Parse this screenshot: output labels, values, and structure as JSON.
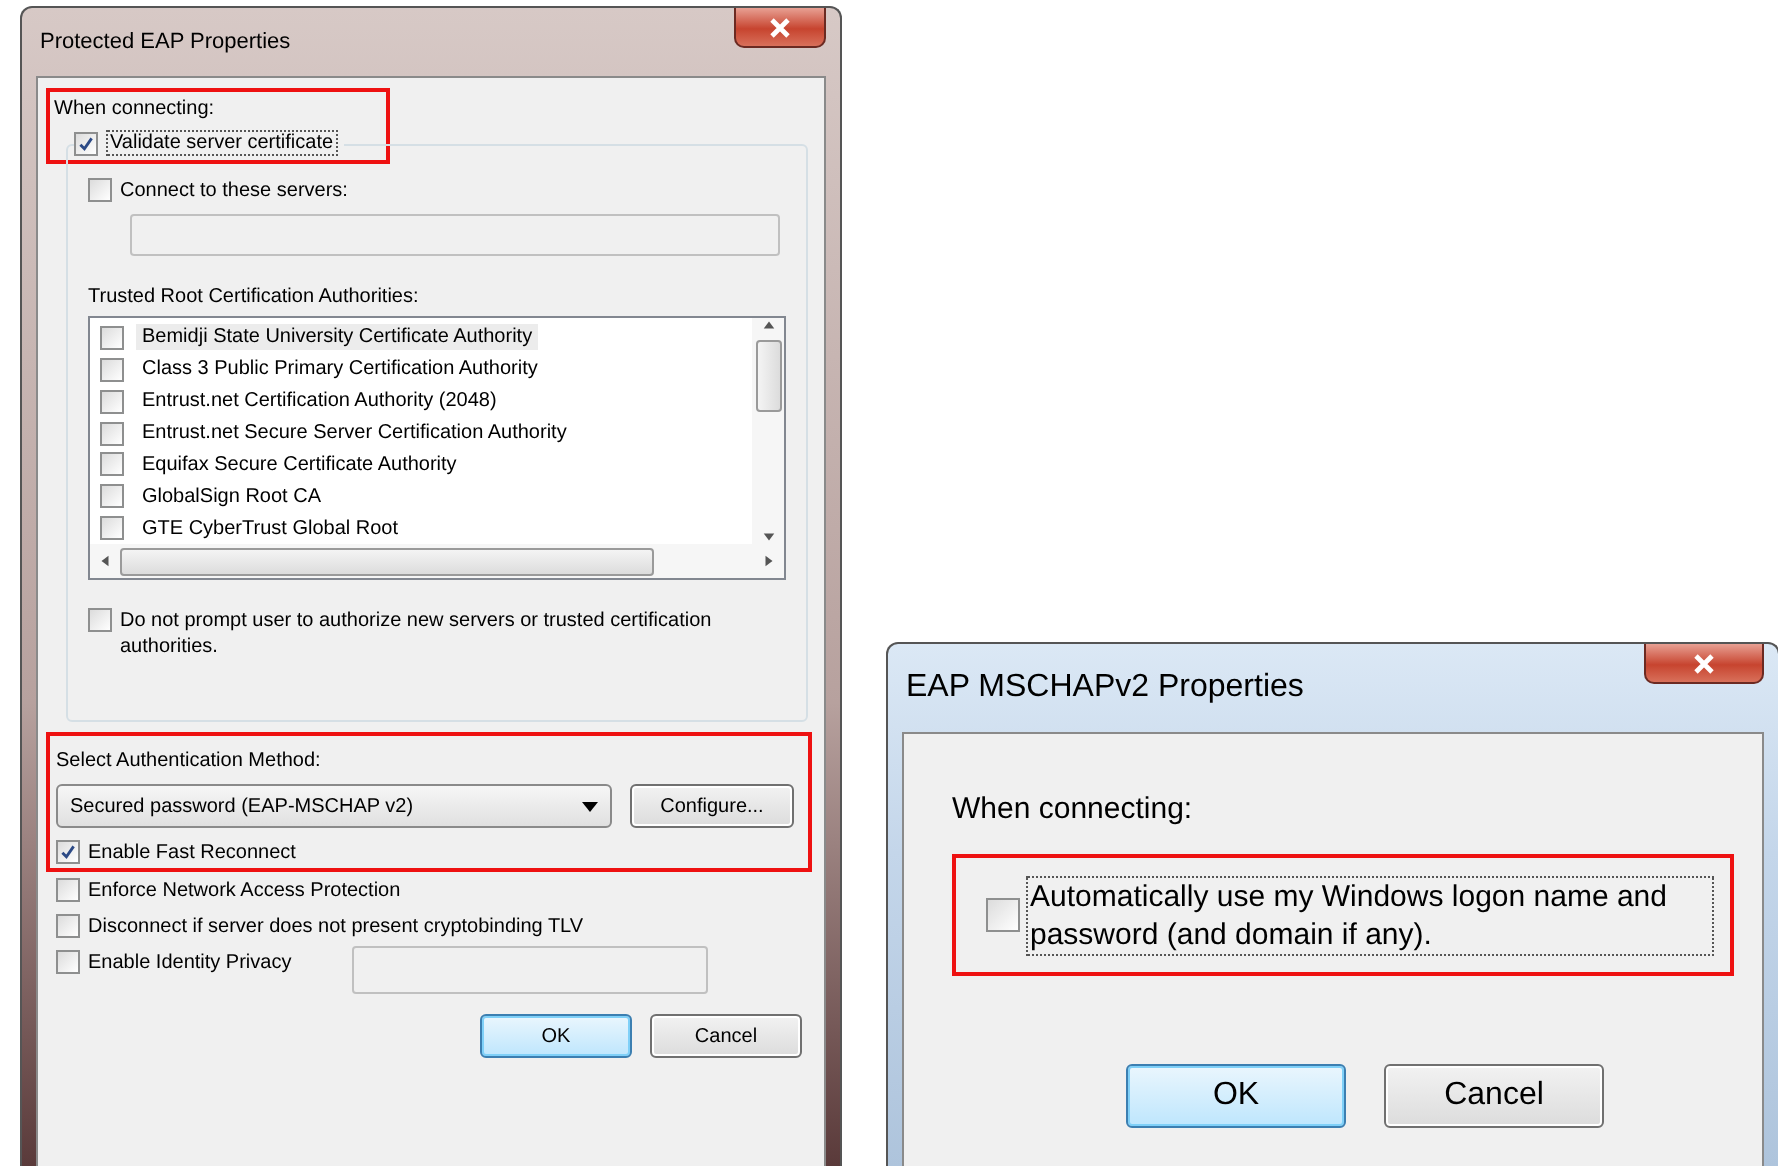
{
  "protected_eap": {
    "title": "Protected EAP Properties",
    "when_connecting": {
      "label": "When connecting:",
      "highlighted": true,
      "validate": {
        "label": "Validate server certificate",
        "checked": true
      }
    },
    "connect_servers": {
      "label": "Connect to these servers:",
      "checked": false
    },
    "trusted_label": "Trusted Root Certification Authorities:",
    "authorities": [
      {
        "name": "Bemidji State University Certificate Authority",
        "checked": false,
        "selected": true
      },
      {
        "name": "Class 3 Public Primary Certification Authority",
        "checked": false,
        "selected": false
      },
      {
        "name": "Entrust.net Certification Authority (2048)",
        "checked": false,
        "selected": false
      },
      {
        "name": "Entrust.net Secure Server Certification Authority",
        "checked": false,
        "selected": false
      },
      {
        "name": "Equifax Secure Certificate Authority",
        "checked": false,
        "selected": false
      },
      {
        "name": "GlobalSign Root CA",
        "checked": false,
        "selected": false
      },
      {
        "name": "GTE CyberTrust Global Root",
        "checked": false,
        "selected": false
      }
    ],
    "no_prompt": {
      "label": "Do not prompt user to authorize new servers or trusted certification authorities.",
      "checked": false
    },
    "auth_method": {
      "label": "Select Authentication Method:",
      "highlighted": true,
      "value": "Secured password (EAP-MSCHAP v2)",
      "configure": "Configure...",
      "fast_reconnect": {
        "label": "Enable Fast Reconnect",
        "checked": true
      }
    },
    "options": [
      {
        "kind": "plain",
        "label": "Enforce Network Access Protection",
        "checked": false
      },
      {
        "kind": "plain",
        "label": "Disconnect if server does not present cryptobinding TLV",
        "checked": false
      },
      {
        "kind": "with-field",
        "label": "Enable Identity Privacy",
        "checked": false
      }
    ],
    "buttons": [
      {
        "label": "OK",
        "default": true
      },
      {
        "label": "Cancel",
        "default": false
      }
    ]
  },
  "mschap": {
    "title": "EAP MSCHAPv2 Properties",
    "label": "When connecting:",
    "auto_logon": {
      "label": "Automatically use my Windows logon name and password (and domain if any).",
      "checked": false,
      "highlighted": true
    },
    "buttons": [
      {
        "label": "OK",
        "default": true
      },
      {
        "label": "Cancel",
        "default": false
      }
    ]
  }
}
